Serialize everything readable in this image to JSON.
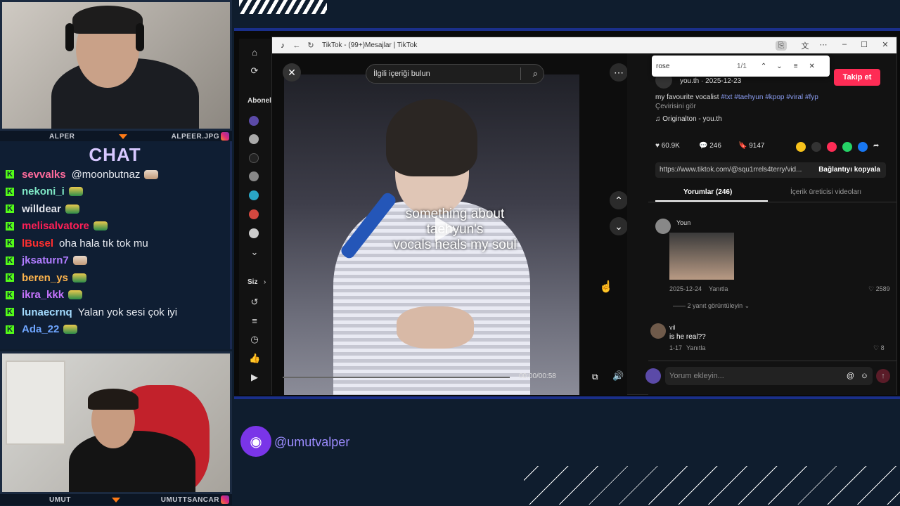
{
  "stream": {
    "cam_top_left_name": "ALPER",
    "cam_top_right_name": "ALPEER.JPG",
    "cam_bottom_left_name": "UMUT",
    "cam_bottom_right_name": "UMUTTSANCAR",
    "chat_title": "CHAT",
    "handle": "@umutvalper",
    "accent_color": "#7a35e8",
    "kick_color": "#53fc18"
  },
  "chat": {
    "messages": [
      {
        "user": "sevvalks",
        "color": "#ff6b9c",
        "text": "@moonbutnaz",
        "emote": "cat"
      },
      {
        "user": "nekoni_i",
        "color": "#7ee7c5",
        "text": "",
        "emote": "pepe"
      },
      {
        "user": "willdear",
        "color": "#e0e3ea",
        "text": "",
        "emote": "pepe"
      },
      {
        "user": "melisalvatore",
        "color": "#ff1f56",
        "text": "",
        "emote": "pepe"
      },
      {
        "user": "lBusel",
        "color": "#ff2f2f",
        "text": "oha hala tık tok mu",
        "emote": ""
      },
      {
        "user": "jksaturn7",
        "color": "#b07cff",
        "text": "",
        "emote": "cat"
      },
      {
        "user": "beren_ys",
        "color": "#ffb54d",
        "text": "",
        "emote": "pepe"
      },
      {
        "user": "ikra_kkk",
        "color": "#c774ff",
        "text": "",
        "emote": "pepe"
      },
      {
        "user": "lunaecrnq",
        "color": "#a4dcff",
        "text": "Yalan yok sesi çok iyi",
        "emote": ""
      },
      {
        "user": "Ada_22",
        "color": "#6fa6ff",
        "text": "",
        "emote": "pepe"
      }
    ]
  },
  "browser": {
    "tab_title": "TikTok - (99+)Mesajlar | TikTok",
    "find_query": "rose",
    "find_count": "1/1"
  },
  "tiktok": {
    "sidebar_following": "Abonel",
    "sidebar_you": "Siz",
    "search_placeholder": "İlgili içeriği bulun",
    "caption_line1": "something about",
    "caption_line2": "taehyun's",
    "caption_line3": "vocals heals my soul",
    "video_time": "00:00/00:58",
    "author_line": "you.th · 2025-12-23",
    "follow_label": "Takip et",
    "description": "my favourite vocalist",
    "hashtags": "#txt #taehyun #kpop #viral #fyp",
    "translate": "Çevirisini gör",
    "sound": "Originalton - you.th",
    "likes": "60.9K",
    "comments_count": "246",
    "saves": "9147",
    "share_url": "https://www.tiktok.com/@squ1rrels4terry/vid...",
    "copy_link": "Bağlantıyı kopyala",
    "tab_comments": "Yorumlar (246)",
    "tab_creator": "İçerik üreticisi videoları",
    "comment1_user": "Youn",
    "comment1_date": "2025-12-24",
    "comment1_reply": "Yanıtla",
    "comment1_likes": "2589",
    "comment1_view_replies": "2 yanıt görüntüleyin",
    "comment2_user": "vil",
    "comment2_text": "is he real??",
    "comment2_date": "1-17",
    "comment2_reply": "Yanıtla",
    "comment2_likes": "8",
    "comment_placeholder": "Yorum ekleyin..."
  }
}
